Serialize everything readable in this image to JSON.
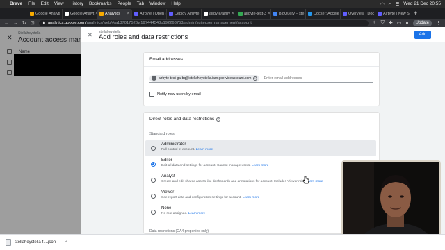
{
  "menubar": {
    "app": "Brave",
    "menus": [
      "File",
      "Edit",
      "View",
      "History",
      "Bookmarks",
      "People",
      "Tab",
      "Window",
      "Help"
    ],
    "clock": "Wed 21 Dec  20:55"
  },
  "tabs": [
    {
      "label": "Google Analyti",
      "color": "#f9ab00"
    },
    {
      "label": "Google Analyt",
      "color": "#ffffff"
    },
    {
      "label": "Analytics",
      "color": "#f9ab00",
      "active": true
    },
    {
      "label": "Airbyte | Open",
      "color": "#615eff"
    },
    {
      "label": "Deploy Airbyte",
      "color": "#615eff"
    },
    {
      "label": "airbyte/airby",
      "color": "#ffffff"
    },
    {
      "label": "airbyte-test-3",
      "color": "#34a853"
    },
    {
      "label": "BigQuery – ste",
      "color": "#4285f4"
    },
    {
      "label": "Docker: Accele",
      "color": "#2496ed"
    },
    {
      "label": "Overview | Doc",
      "color": "#615eff"
    },
    {
      "label": "Airbyte | New S",
      "color": "#615eff"
    }
  ],
  "address": {
    "host": "analytics.google.com",
    "path": "/analytics/web/#/a137017526w197444548p192263753/admin/suiteusermanagement/account",
    "update_label": "Update"
  },
  "background": {
    "subtitle": "Stellaheystella",
    "title": "Account access manager",
    "name_header": "Name"
  },
  "dialog": {
    "subtitle": "stellaheystella",
    "title": "Add roles and data restrictions",
    "add_label": "Add"
  },
  "email_card": {
    "title": "Email addresses",
    "chip_email": "airbyte-test-ga-bq@stellaheystella.iam.gserviceaccount.com",
    "input_placeholder": "Enter email addresses",
    "notify_label": "Notify new users by email"
  },
  "roles_card": {
    "title": "Direct roles and data restrictions",
    "standard_label": "Standard roles",
    "learn_more": "Learn more",
    "roles": [
      {
        "name": "Administrator",
        "desc": "Full control of account.",
        "selected": false,
        "hovered": true
      },
      {
        "name": "Editor",
        "desc": "Edit all data and settings for account. Cannot manage users.",
        "selected": true
      },
      {
        "name": "Analyst",
        "desc": "Create and edit shared assets like dashboards and annotations for account. Includes Viewer role.",
        "selected": false
      },
      {
        "name": "Viewer",
        "desc": "See report data and configuration settings for account.",
        "selected": false
      },
      {
        "name": "None",
        "desc": "No role assigned.",
        "selected": false
      }
    ],
    "data_restrictions_label": "Data restrictions (GA4 properties only)"
  },
  "downloads": {
    "file": "stellaheystella-f....json"
  }
}
